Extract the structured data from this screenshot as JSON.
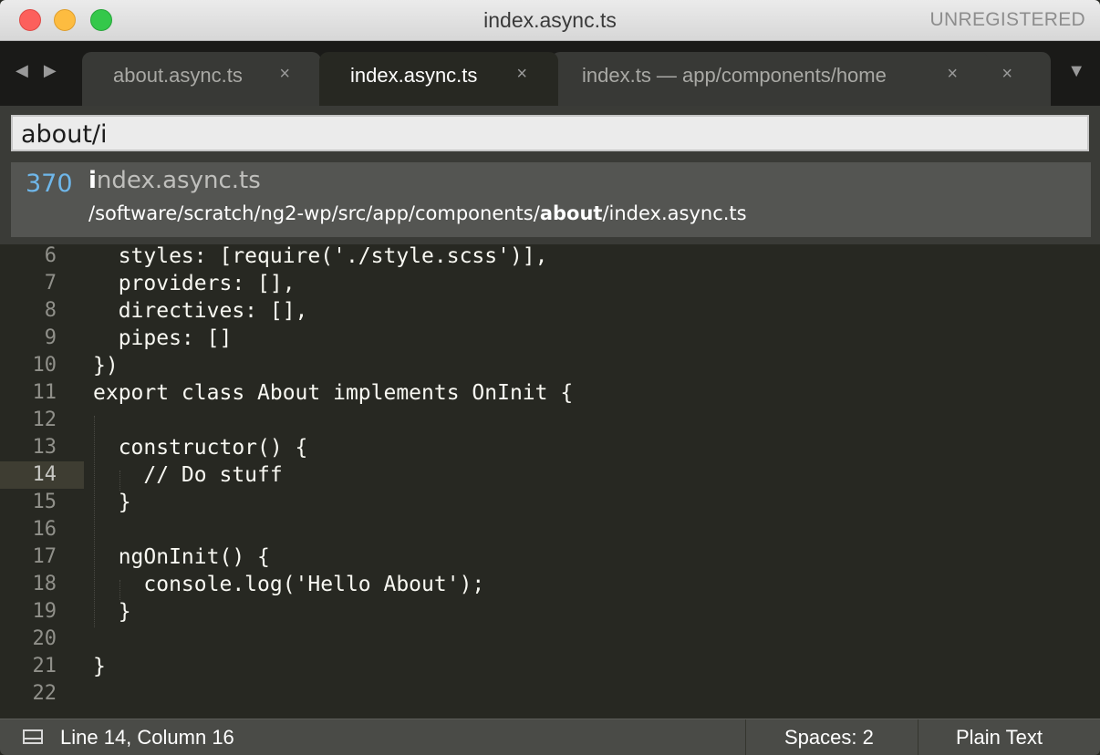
{
  "window": {
    "title": "index.async.ts",
    "registration": "UNREGISTERED"
  },
  "tabbar": {
    "nav_arrows": "◀ ▶",
    "tabs": [
      {
        "label": "about.async.ts",
        "close": "×",
        "active": false
      },
      {
        "label": "index.async.ts",
        "close": "×",
        "active": true
      },
      {
        "label": "index.ts — app/components/home",
        "close": "×",
        "active": false
      },
      {
        "label": "",
        "close": "×",
        "active": false
      }
    ],
    "overflow": "▼"
  },
  "goto_anything": {
    "query": "about/i",
    "results": [
      {
        "score": "370",
        "name_match": "i",
        "name_rest": "ndex.async.ts",
        "path_prefix": "/software/scratch/ng2-wp/src/app/components/",
        "path_match": "about",
        "path_suffix": "/index.async.ts"
      }
    ]
  },
  "editor": {
    "current_line": 14,
    "lines": [
      {
        "n": "6",
        "text": "  styles: [require('./style.scss')],"
      },
      {
        "n": "7",
        "text": "  providers: [],"
      },
      {
        "n": "8",
        "text": "  directives: [],"
      },
      {
        "n": "9",
        "text": "  pipes: []"
      },
      {
        "n": "10",
        "text": "})"
      },
      {
        "n": "11",
        "text": "export class About implements OnInit {"
      },
      {
        "n": "12",
        "text": ""
      },
      {
        "n": "13",
        "text": "  constructor() {"
      },
      {
        "n": "14",
        "text": "    // Do stuff"
      },
      {
        "n": "15",
        "text": "  }"
      },
      {
        "n": "16",
        "text": ""
      },
      {
        "n": "17",
        "text": "  ngOnInit() {"
      },
      {
        "n": "18",
        "text": "    console.log('Hello About');"
      },
      {
        "n": "19",
        "text": "  }"
      },
      {
        "n": "20",
        "text": ""
      },
      {
        "n": "21",
        "text": "}"
      },
      {
        "n": "22",
        "text": ""
      }
    ]
  },
  "statusbar": {
    "position": "Line 14, Column 16",
    "indentation": "Spaces: 2",
    "syntax": "Plain Text"
  }
}
